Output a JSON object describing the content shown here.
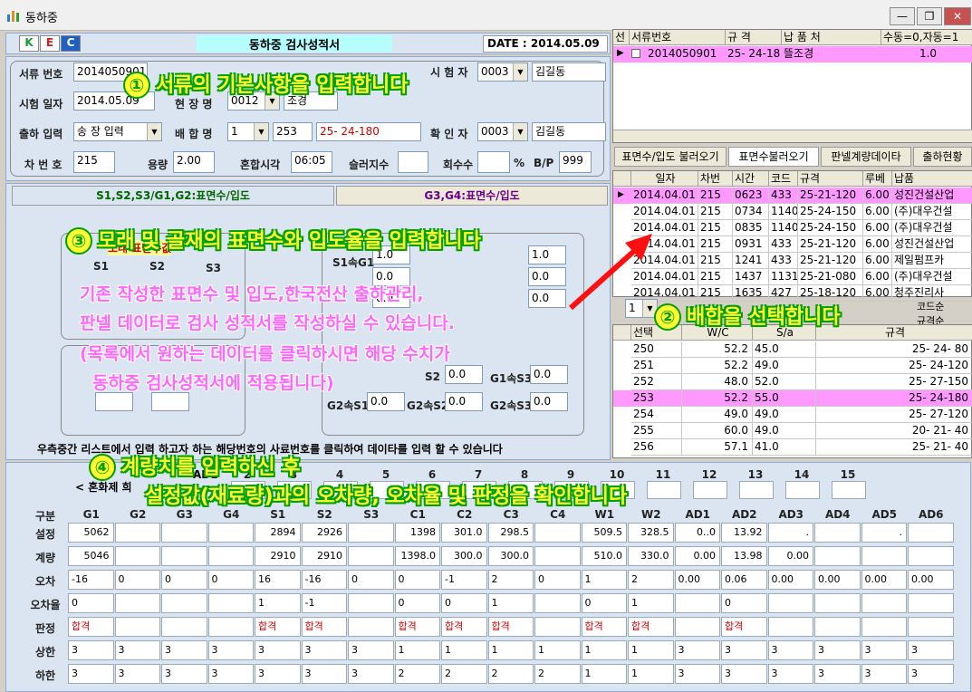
{
  "window": {
    "title": "동하중",
    "min": "—",
    "max": "❐",
    "close": "✕"
  },
  "header": {
    "logo_k": "K",
    "logo_e": "E",
    "logo_c": "C",
    "doc_title": "동하중 검사성적서",
    "date": "DATE : 2014.05.09"
  },
  "basic": {
    "doc_no_label": "서류 번호",
    "doc_no": "2014050901",
    "tester_label": "시 험 자",
    "tester_code": "0003",
    "tester_name": "김길동",
    "test_date_label": "시험 일자",
    "test_date": "2014.05.09",
    "site_label": "현 장 명",
    "site_code": "0012",
    "site_name": "조경",
    "ship_label": "출하 입력",
    "ship_value": "송 장 입력",
    "mix_label": "배 합 명",
    "mix_code": "1",
    "mix_no": "253",
    "mix_spec": "25- 24-180",
    "confirm_label": "확 인 자",
    "confirm_code": "0003",
    "confirm_name": "김길동",
    "car_label": "차 번 호",
    "car_value": "215",
    "vol_label": "용량",
    "vol_value": "2.00",
    "mixtime_label": "혼합시각",
    "mixtime_value": "06:05",
    "slurry_label": "슬러지수",
    "slurry_value": "",
    "count_label": "회수수",
    "count_value": "",
    "pct": "%",
    "bp_label": "B/P",
    "bp_value": "999"
  },
  "tabs_left": {
    "tab1": "S1,S2,S3/G1,G2:표면수/입도",
    "tab2": "G3,G4:표면수/입도"
  },
  "sandbox": {
    "sand_title": "모래 표면수값",
    "s1": "S1",
    "s2": "S2",
    "s3": "S3",
    "g1s": "S1속G1",
    "g1s_val": "1.0",
    "g2s_val": "1.0",
    "v1": "0.0",
    "v2": "0.0",
    "v3": "0.0",
    "v4": "0.0",
    "s2a": "S2",
    "s2a_val": "0.0",
    "g1s3": "G1속S3",
    "g1s3_val": "0.0",
    "g2s1": "G2속S1",
    "g2s1_val": "0.0",
    "g2s2": "G2속S2",
    "g2s2_val": "0.0",
    "g2s3": "G2속S3",
    "g2s3_val": "0.0",
    "footer": "우측중간 리스트에서 입력 하고자 하는 해당번호의 사료번호를 클릭하여 데이타를 입력 할 수 있습니다"
  },
  "top_grid": {
    "headers": [
      "선",
      "서류번호",
      "규 격",
      "납 품 처",
      "수동=0,자동=1"
    ],
    "rows": [
      {
        "doc": "2014050901",
        "spec": "25- 24-18",
        "dest": "뜰조경",
        "mode": "1.0"
      }
    ]
  },
  "right_tabs": {
    "t1": "표면수/입도 불러오기",
    "t2": "표면수불러오기",
    "t3": "판넬계량데이타",
    "t4": "출하현황"
  },
  "ship_grid": {
    "headers": [
      "일자",
      "차번",
      "시간",
      "코드",
      "규격",
      "루베",
      "납품"
    ],
    "rows": [
      [
        "2014.04.01",
        "215",
        "0623",
        "433",
        "25-21-120",
        "6.00",
        "성진건설산업"
      ],
      [
        "2014.04.01",
        "215",
        "0734",
        "1140",
        "25-24-150",
        "6.00",
        "(주)대우건설"
      ],
      [
        "2014.04.01",
        "215",
        "0835",
        "1140",
        "25-24-150",
        "6.00",
        "(주)대우건설"
      ],
      [
        "2014.04.01",
        "215",
        "0931",
        "433",
        "25-21-120",
        "6.00",
        "성진건설산업"
      ],
      [
        "2014.04.01",
        "215",
        "1241",
        "433",
        "25-21-120",
        "6.00",
        "제일펌프카"
      ],
      [
        "2014.04.01",
        "215",
        "1437",
        "1131",
        "25-21-080",
        "6.00",
        "(주)대우건설"
      ],
      [
        "2014.04.01",
        "215",
        "1635",
        "427",
        "25-18-120",
        "6.00",
        "청주진리사"
      ]
    ]
  },
  "mix_select": {
    "value": "1",
    "opt1": "코드순",
    "opt2": "규격순"
  },
  "mix_grid": {
    "headers": [
      "선택",
      "W/C",
      "S/a",
      "규격"
    ],
    "rows": [
      [
        "250",
        "52.2",
        "45.0",
        "25- 24- 80"
      ],
      [
        "251",
        "52.2",
        "49.0",
        "25- 24-120"
      ],
      [
        "252",
        "48.0",
        "52.0",
        "25- 27-150"
      ],
      [
        "253",
        "52.2",
        "55.0",
        "25- 24-180"
      ],
      [
        "254",
        "49.0",
        "49.0",
        "25- 27-120"
      ],
      [
        "255",
        "60.0",
        "49.0",
        "20- 21- 40"
      ],
      [
        "256",
        "57.1",
        "41.0",
        "25- 21- 40"
      ]
    ]
  },
  "bottom": {
    "mix_note": "< 혼화제 희",
    "ad_label": "AD1",
    "col_nums": [
      "2",
      "3",
      "4",
      "5",
      "6",
      "7",
      "8",
      "9",
      "10",
      "11",
      "12",
      "13",
      "14",
      "15"
    ],
    "headers": [
      "구분",
      "G1",
      "G2",
      "G3",
      "G4",
      "S1",
      "S2",
      "S3",
      "C1",
      "C2",
      "C3",
      "C4",
      "W1",
      "W2",
      "AD1",
      "AD2",
      "AD3",
      "AD4",
      "AD5",
      "AD6"
    ],
    "row_labels": [
      "설정",
      "계량",
      "오차",
      "오차율",
      "판정",
      "상한",
      "하한"
    ],
    "rows": [
      [
        "5062",
        "",
        "",
        "",
        "2894",
        "2926",
        "",
        "1398",
        "301.0",
        "298.5",
        "",
        "509.5",
        "328.5",
        "0..0",
        "13.92",
        ".",
        "",
        ".",
        ""
      ],
      [
        "5046",
        "",
        "",
        "",
        "2910",
        "2910",
        "",
        "1398.0",
        "300.0",
        "300.0",
        "",
        "510.0",
        "330.0",
        "0.00",
        "13.98",
        "0.00",
        "",
        "",
        ""
      ],
      [
        "-16",
        "0",
        "0",
        "0",
        "16",
        "-16",
        "0",
        "0",
        "-1",
        "2",
        "0",
        "1",
        "2",
        "0.00",
        "0.06",
        "0.00",
        "0.00",
        "0.00",
        "0.00"
      ],
      [
        "0",
        "",
        "",
        "",
        "1",
        "-1",
        "",
        "0",
        "0",
        "1",
        "",
        "0",
        "1",
        "",
        "0",
        "",
        "",
        "",
        ""
      ],
      [
        "합격",
        "",
        "",
        "",
        "합격",
        "합격",
        "",
        "합격",
        "합격",
        "합격",
        "",
        "합격",
        "합격",
        "",
        "합격",
        "",
        "",
        "",
        ""
      ],
      [
        "3",
        "3",
        "3",
        "3",
        "3",
        "3",
        "3",
        "1",
        "1",
        "1",
        "1",
        "1",
        "1",
        "3",
        "3",
        "3",
        "3",
        "3",
        "3"
      ],
      [
        "3",
        "3",
        "3",
        "3",
        "3",
        "3",
        "3",
        "2",
        "2",
        "2",
        "2",
        "1",
        "1",
        "3",
        "3",
        "3",
        "3",
        "3",
        "3"
      ]
    ]
  },
  "annotations": {
    "a1": "서류의 기본사항을 입력합니다",
    "n1": "①",
    "a2": "배합을 선택합니다",
    "n2": "②",
    "a3": "모래 및 골재의 표면수와 입도율을 입력합니다",
    "n3": "③",
    "a4a": "계량치를 입력하신 후",
    "n4": "④",
    "a4b": "설정값(재료량)과의 오차량, 오차율 및 판정을 확인합니다",
    "note1": "기존 작성한 표면수 및 입도,한국전산 출하관리,",
    "note2": "판넬 데이터로 검사 성적서를 작성하실 수 있습니다.",
    "note3": "(목록에서 원하는 데이터를 클릭하시면 해당 수치가",
    "note4": "동하중 검사성적서에 적용됩니다)"
  },
  "colors": {
    "accent": "#ff99ff",
    "annotation": "#ffff33",
    "annotation_outline": "#00a000",
    "pass": "#d00000"
  }
}
